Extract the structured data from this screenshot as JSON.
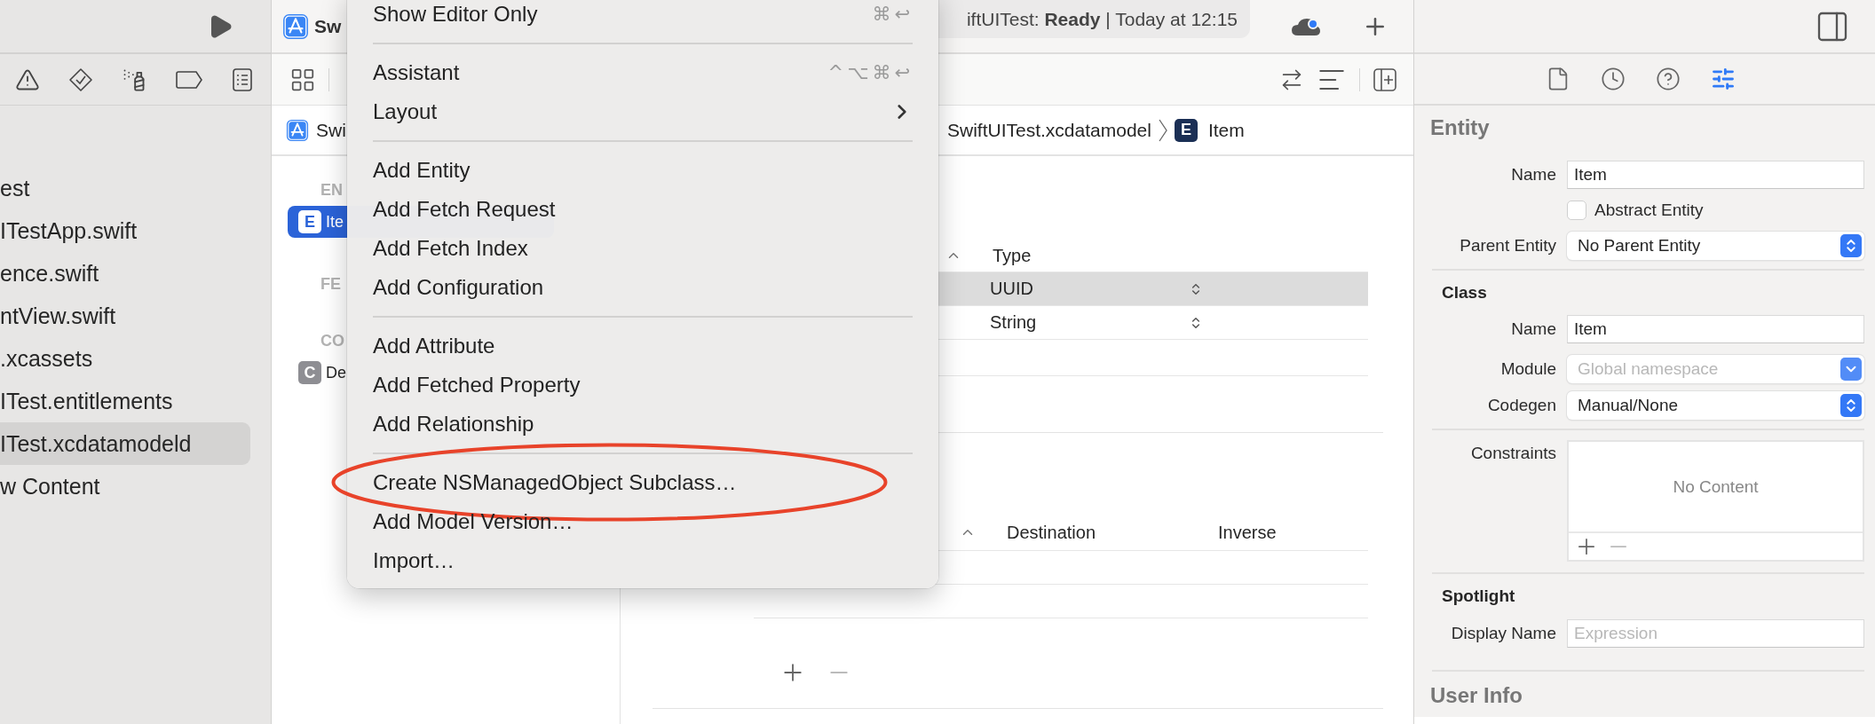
{
  "navigator": {
    "files": [
      {
        "label": "est",
        "selected": false
      },
      {
        "label": "ITestApp.swift",
        "selected": false
      },
      {
        "label": "ence.swift",
        "selected": false
      },
      {
        "label": "ntView.swift",
        "selected": false
      },
      {
        "label": ".xcassets",
        "selected": false
      },
      {
        "label": "ITest.entitlements",
        "selected": false
      },
      {
        "label": "ITest.xcdatamodeld",
        "selected": true
      },
      {
        "label": "w Content",
        "selected": false
      }
    ]
  },
  "toolbar": {
    "title": "Sw",
    "status": "iftUITest: **Ready** | Today at 12:15"
  },
  "jump_bar": {
    "first": "Swi",
    "model": "SwiftUITest.xcdatamodel",
    "badge": "E",
    "current": "Item"
  },
  "entities_pane": {
    "sections": [
      {
        "header": "EN",
        "items": [
          {
            "badge": "E",
            "label": "Ite",
            "selected": true
          }
        ]
      },
      {
        "header": "FE"
      },
      {
        "header": "CO",
        "items": [
          {
            "badge": "C",
            "label": "De",
            "selected": false
          }
        ]
      }
    ]
  },
  "attributes": {
    "columns": [
      "Type"
    ],
    "rows": [
      {
        "type": "UUID",
        "selected": true
      },
      {
        "type": "String",
        "selected": false
      }
    ]
  },
  "relationships": {
    "columns": [
      "Destination",
      "Inverse"
    ]
  },
  "context_menu": {
    "groups": [
      [
        {
          "label": "Show Editor Only",
          "shortcut": "⌘↩",
          "submenu": false,
          "circled": false
        }
      ],
      [
        {
          "label": "Assistant",
          "shortcut": "^⌥⌘↩",
          "submenu": false,
          "circled": false
        },
        {
          "label": "Layout",
          "submenu": true,
          "circled": false
        }
      ],
      [
        {
          "label": "Add Entity",
          "submenu": false,
          "circled": false
        },
        {
          "label": "Add Fetch Request",
          "submenu": false,
          "circled": false
        },
        {
          "label": "Add Fetch Index",
          "submenu": false,
          "circled": false
        },
        {
          "label": "Add Configuration",
          "submenu": false,
          "circled": false
        }
      ],
      [
        {
          "label": "Add Attribute",
          "submenu": false,
          "circled": false
        },
        {
          "label": "Add Fetched Property",
          "submenu": false,
          "circled": false
        },
        {
          "label": "Add Relationship",
          "submenu": false,
          "circled": false
        }
      ],
      [
        {
          "label": "Create NSManagedObject Subclass…",
          "submenu": false,
          "circled": true
        },
        {
          "label": "Add Model Version…",
          "submenu": false,
          "circled": false
        },
        {
          "label": "Import…",
          "submenu": false,
          "circled": false
        }
      ]
    ]
  },
  "inspector": {
    "tabs": [
      {
        "selected": false
      },
      {
        "selected": false
      },
      {
        "selected": false
      },
      {
        "selected": true
      }
    ],
    "entity": {
      "title": "Entity",
      "name_label": "Name",
      "name": "Item",
      "abstract_label": "Abstract Entity",
      "abstract": false,
      "parent_label": "Parent Entity",
      "parent": "No Parent Entity"
    },
    "class": {
      "title": "Class",
      "name_label": "Name",
      "name": "Item",
      "module_label": "Module",
      "module_placeholder": "Global namespace",
      "module_disabled": true,
      "codegen_label": "Codegen",
      "codegen": "Manual/None"
    },
    "constraints": {
      "label": "Constraints",
      "empty": "No Content"
    },
    "spotlight": {
      "title": "Spotlight",
      "display_name_label": "Display Name",
      "display_name_placeholder": "Expression"
    },
    "user_info": {
      "title": "User Info"
    }
  }
}
